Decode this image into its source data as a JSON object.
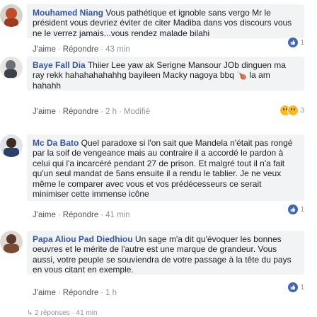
{
  "comments": [
    {
      "author": "Mouhamed Niang",
      "text": " Vous pathétique et ignoble sans vergo Mr le président vous devriez éviter de citer Madiba dans vos discours vous ne le verrez jamais...vous rendez malade bilahi",
      "like": "J'aime",
      "reply": "Répondre",
      "time": "43 min",
      "modified": "",
      "reaction_count": "1",
      "avatar_color": "#c24b2a"
    },
    {
      "author": "Baye Fall Dia",
      "text": " Thiier Lee yaw ak Serigne Mansour JOb dinguen ma ray rekk hahahahahahhg bayileen Macky nagoya bbq 🍗 la am hahahh",
      "like": "J'aime",
      "reply": "Répondre",
      "time": "2 h",
      "modified": "Modifié",
      "reaction_count": "3",
      "avatar_color": "#6b6f7a"
    },
    {
      "author": "Mc Da Bato",
      "text": " Quel paradoxe si l'on sait que Mandela n'était pas rongé par la soif de vengeance mais au contraire il a accordé le pardon à celui qui l'a incarcéré pendant 27 de prison. Et malgré tout il n'a fait qu'un seul mandat de 5ans ensuite il a rendu le tablier. Je ne veux même le comparer avec vous et vos prédécesseurs ce serait minimiser cette immense icône",
      "like": "J'aime",
      "reply": "Répondre",
      "time": "41 min",
      "modified": "",
      "reaction_count": "1",
      "avatar_color": "#2b3f6b"
    },
    {
      "author": "Papa Aliou Pad Diedhiou",
      "text": " Un sage m'a dit qu'évoquer les bonnes oeuvres et le mérite de l'autre est une marque de grandeur. Vous aussi, votre peuple se souviendra de votre passage à la tête du pays en vous citant en exemple.",
      "like": "J'aime",
      "reply": "Répondre",
      "time": "1 h",
      "modified": "",
      "reaction_count": "1",
      "avatar_color": "#7a4a34"
    }
  ],
  "footer": {
    "replies_text": "2 réponses · 41 min"
  },
  "separator": "·"
}
